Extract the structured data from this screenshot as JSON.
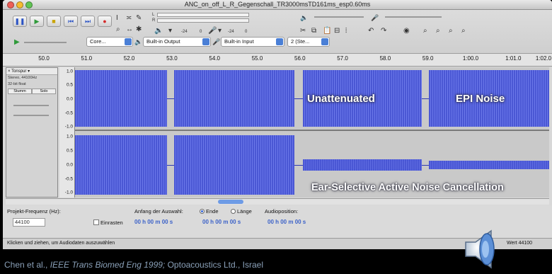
{
  "window": {
    "title": "ANC_on_off_L_R_Gegenschall_TR3000msTD161ms_esp0.60ms"
  },
  "toolbar": {
    "record_meter_ticks": [
      "-24",
      "0",
      "-24",
      "0"
    ],
    "output_device": "Core...",
    "output_label": "Built-in Output",
    "input_label": "Built-in Input",
    "channels_label": "2 (Ste..."
  },
  "ruler": {
    "ticks": [
      "50.0",
      "51.0",
      "52.0",
      "53.0",
      "54.0",
      "55.0",
      "56.0",
      "57.0",
      "58.0",
      "59.0",
      "1:00.0",
      "1:01.0",
      "1:02.0"
    ]
  },
  "track": {
    "name": "Tonspur",
    "info_1": "Stereo, 44100Hz",
    "info_2": "32-bit float",
    "mute": "Stumm",
    "solo": "Solo",
    "y_ticks_top": [
      "1.0",
      "0.5",
      "0.0",
      "-0.5",
      "-1.0"
    ],
    "y_ticks_bottom": [
      "1.0",
      "0.5",
      "0.0",
      "-0.5",
      "-1.0"
    ]
  },
  "overlay": {
    "unattenuated": "Unattenuated",
    "epi_noise": "EPI Noise",
    "anc": "Ear-Selective Active Noise Cancellation"
  },
  "selection_bar": {
    "rate_label": "Projekt-Frequenz (Hz):",
    "rate_value": "44100",
    "snap_label": "Einrasten",
    "selection_label": "Anfang der Auswahl:",
    "end_label": "Ende",
    "length_label": "Länge",
    "audio_pos_label": "Audioposition:",
    "time_1": "00 h 00 m 00 s",
    "time_2": "00 h 00 m 00 s",
    "time_3": "00 h 00 m 00 s"
  },
  "status": {
    "hint": "Klicken und ziehen, um Audiodaten auszuwählen",
    "rate": "Wert 44100"
  },
  "citation": {
    "authors": "Chen et al., ",
    "journal": "IEEE Trans Biomed Eng 1999;",
    "rest": " Optoacoustics Ltd., Israel"
  },
  "colors": {
    "waveform": "#4a57d4",
    "background": "#000000",
    "accent": "#3c62c8"
  }
}
